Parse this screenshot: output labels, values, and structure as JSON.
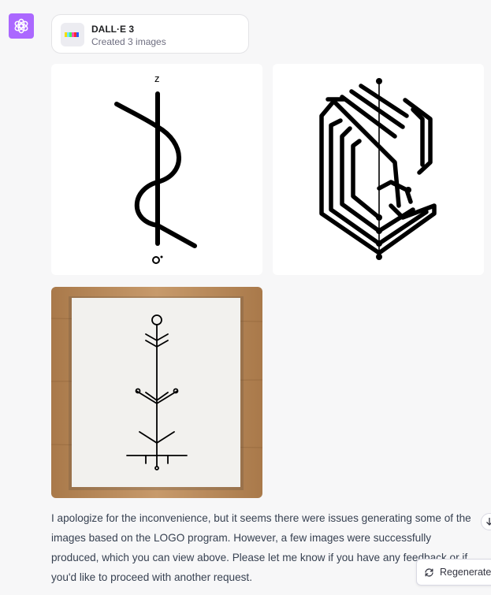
{
  "assistant": {
    "avatar_icon": "openai-logo-icon",
    "avatar_color": "#ab68ff"
  },
  "tool_card": {
    "title": "DALL·E 3",
    "subtitle": "Created 3 images",
    "icon": "dalle-palette-icon"
  },
  "images": [
    {
      "label": "generated-image-1",
      "description": "black line symbol"
    },
    {
      "label": "generated-image-2",
      "description": "black line emblem"
    },
    {
      "label": "generated-image-3",
      "description": "canvas with tree symbol"
    }
  ],
  "message": {
    "text": "I apologize for the inconvenience, but it seems there were issues generating some of the images based on the LOGO program. However, a few images were successfully produced, which you can view above. Please let me know if you have any feedback or if you'd like to proceed with another request."
  },
  "controls": {
    "regenerate_label": "Regenerate",
    "scroll_icon": "arrow-down-icon"
  },
  "colors": {
    "background": "#f7f7f8",
    "accent": "#ab68ff"
  }
}
